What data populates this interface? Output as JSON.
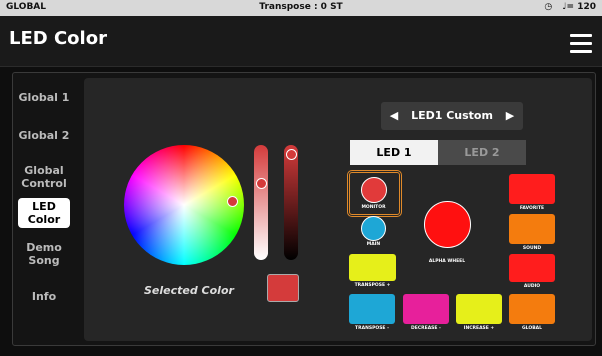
{
  "statusbar": {
    "left": "GLOBAL",
    "center": "Transpose : 0 ST",
    "tempo": "♩= 120"
  },
  "header": {
    "title": "LED Color"
  },
  "sidebar": {
    "items": [
      {
        "label": "Global 1"
      },
      {
        "label": "Global 2"
      },
      {
        "label": "Global Control"
      },
      {
        "label": "LED Color"
      },
      {
        "label": "Demo Song"
      },
      {
        "label": "Info"
      }
    ]
  },
  "color": {
    "selected_label": "Selected Color",
    "selected_hex": "#d43b3b"
  },
  "led_select": {
    "label": "LED1 Custom"
  },
  "tabs": [
    {
      "label": "LED 1"
    },
    {
      "label": "LED 2"
    }
  ],
  "leds": {
    "monitor": "MONITOR",
    "main": "MAIN",
    "alpha_wheel": "ALPHA WHEEL",
    "transpose_plus": "TRANSPOSE +",
    "transpose_minus": "TRANSPOSE -",
    "decrease_minus": "DECREASE -",
    "increase_plus": "INCREASE +",
    "favorite": "FAVORITE",
    "sound": "SOUND",
    "audio": "AUDIO",
    "global": "GLOBAL"
  }
}
